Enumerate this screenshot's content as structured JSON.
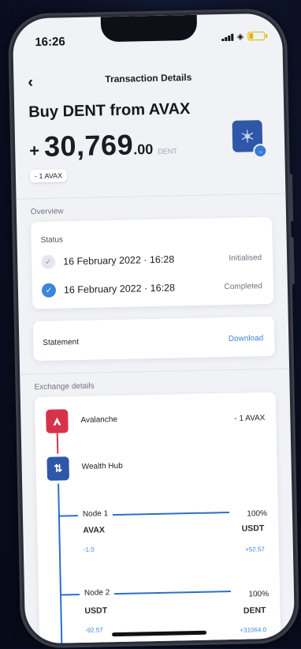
{
  "status_bar": {
    "time": "16:26"
  },
  "nav": {
    "back_icon": "chevron-left-icon",
    "title": "Transaction Details"
  },
  "transaction": {
    "title": "Buy DENT from AVAX",
    "sign": "+",
    "amount_whole": "30,769",
    "amount_decimal": ".00",
    "currency": "DENT",
    "spent": "- 1 AVAX"
  },
  "overview": {
    "label": "Overview",
    "status_heading": "Status",
    "steps": [
      {
        "date": "16 February 2022 · 16:28",
        "state": "Initialised"
      },
      {
        "date": "16 February 2022 · 16:28",
        "state": "Completed"
      }
    ]
  },
  "statement": {
    "label": "Statement",
    "action": "Download"
  },
  "exchange": {
    "label": "Exchange details",
    "source": {
      "name": "Avalanche",
      "amount": "- 1 AVAX",
      "color": "#d6334b"
    },
    "hub": {
      "name": "Wealth Hub",
      "color": "#2f57a8"
    },
    "nodes": [
      {
        "label": "Node 1",
        "pct": "100%",
        "from": "AVAX",
        "from_val": "-1.0",
        "to": "USDT",
        "to_val": "+52.57"
      },
      {
        "label": "Node 2",
        "pct": "100%",
        "from": "USDT",
        "from_val": "-92.57",
        "to": "DENT",
        "to_val": "+31064.0"
      }
    ]
  },
  "colors": {
    "accent": "#3e86d9",
    "line": "#2d6fc8"
  }
}
